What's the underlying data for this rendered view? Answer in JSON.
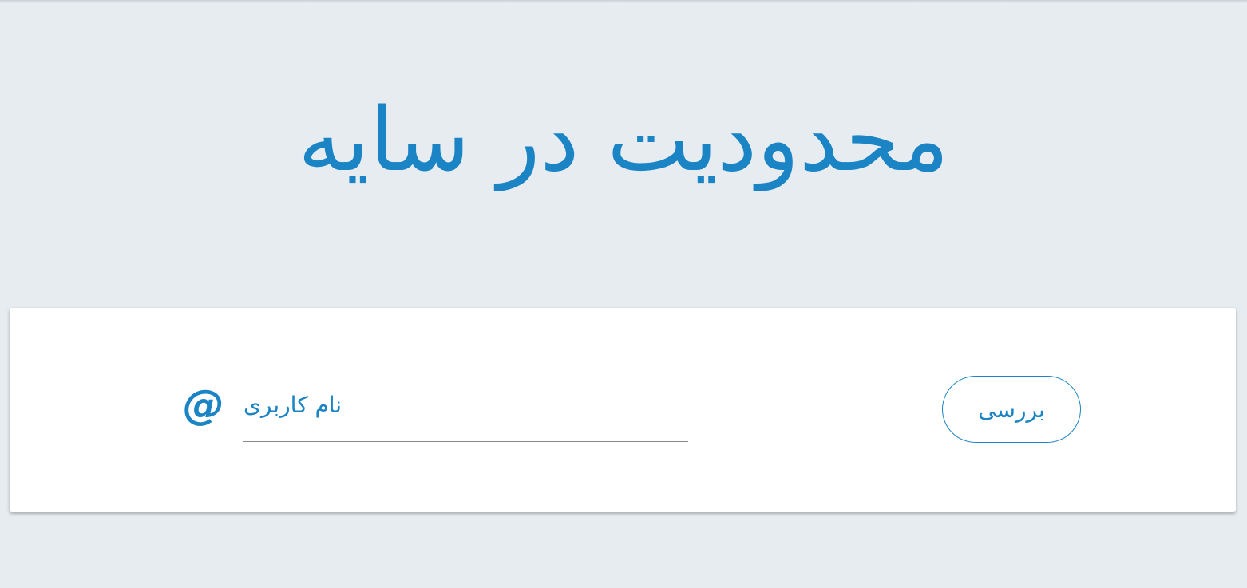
{
  "page": {
    "title": "محدودیت در سایه"
  },
  "form": {
    "username_placeholder": "نام کاربری",
    "username_value": "",
    "at_symbol": "@",
    "check_button_label": "بررسی"
  },
  "colors": {
    "accent": "#1a84c5",
    "background": "#e7ecf1",
    "card": "#ffffff",
    "underline": "#8a8a8a"
  },
  "icons": {
    "at": "at-sign-icon"
  }
}
